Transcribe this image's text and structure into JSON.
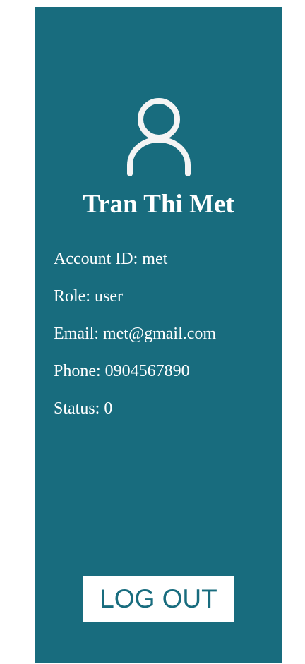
{
  "profile": {
    "icon": "user-icon",
    "name": "Tran Thi Met",
    "account_id": "Account ID: met",
    "role": "Role: user",
    "email": "Email: met@gmail.com",
    "phone": "Phone: 0904567890",
    "status": "Status: 0"
  },
  "actions": {
    "logout_label": "LOG OUT"
  },
  "colors": {
    "panel": "#186c7e",
    "text": "#ffffff",
    "button_bg": "#ffffff",
    "button_text": "#186c7e"
  }
}
